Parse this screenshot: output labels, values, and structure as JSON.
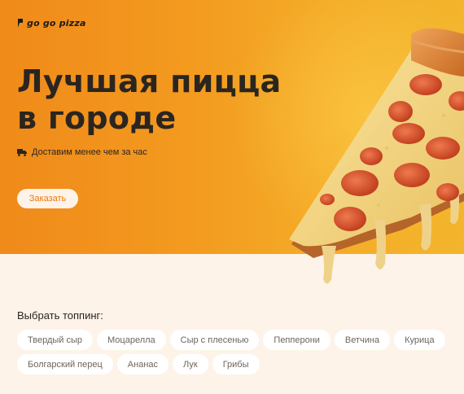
{
  "brand": {
    "logo_text": "go go pizza",
    "logo_icon": "flag-icon"
  },
  "hero": {
    "title_line1": "Лучшая пицца",
    "title_line2": "в городе",
    "delivery_icon": "truck-icon",
    "delivery_text": "Доставим менее чем за час",
    "order_button": "Заказать"
  },
  "toppings": {
    "title": "Выбрать топпинг:",
    "row1": [
      "Твердый сыр",
      "Моцарелла",
      "Сыр с плесенью",
      "Пепперони",
      "Ветчина",
      "Курица"
    ],
    "row2": [
      "Болгарский перец",
      "Ананас",
      "Лук",
      "Грибы"
    ]
  },
  "colors": {
    "accent": "#f39a1f",
    "text": "#2b2520",
    "background": "#fdf3e9",
    "chip": "#ffffff"
  }
}
